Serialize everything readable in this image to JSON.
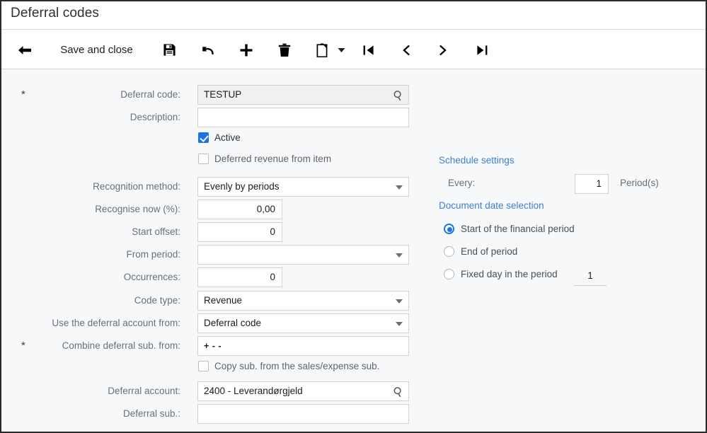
{
  "window": {
    "title": "Deferral codes"
  },
  "toolbar": {
    "back_icon": "back-arrow-icon",
    "save_and_close_label": "Save and close",
    "save_icon": "save-floppy-icon",
    "undo_icon": "undo-arrow-icon",
    "add_icon": "plus-icon",
    "delete_icon": "trash-icon",
    "clipboard_icon": "clipboard-icon",
    "clipboard_caret": "chevron-down-icon",
    "first_icon": "first-record-icon",
    "prev_icon": "previous-record-icon",
    "next_icon": "next-record-icon",
    "last_icon": "last-record-icon"
  },
  "form": {
    "deferral_code": {
      "label": "Deferral code:",
      "value": "TESTUP",
      "required": "*",
      "icon": "magnifier-icon"
    },
    "description": {
      "label": "Description:",
      "value": ""
    },
    "active": {
      "label": "Active",
      "checked": "true"
    },
    "deferred_revenue_from_item": {
      "label": "Deferred revenue from item",
      "checked": "false"
    },
    "recognition_method": {
      "label": "Recognition method:",
      "value": "Evenly by periods",
      "icon": "chevron-down-icon"
    },
    "recognise_now": {
      "label": "Recognise now (%):",
      "value": "0,00"
    },
    "start_offset": {
      "label": "Start offset:",
      "value": "0"
    },
    "from_period": {
      "label": "From period:",
      "value": "",
      "icon": "chevron-down-icon"
    },
    "occurrences": {
      "label": "Occurrences:",
      "value": "0"
    },
    "code_type": {
      "label": "Code type:",
      "value": "Revenue",
      "icon": "chevron-down-icon"
    },
    "use_deferral_account_from": {
      "label": "Use the deferral account from:",
      "value": "Deferral code",
      "icon": "chevron-down-icon"
    },
    "combine_deferral_sub_from": {
      "label": "Combine deferral sub. from:",
      "value": "+ -  -",
      "required": "*"
    },
    "copy_sub": {
      "label": "Copy sub. from the sales/expense sub.",
      "checked": "false"
    },
    "deferral_account": {
      "label": "Deferral account:",
      "value": "2400 - Leverandørgjeld",
      "icon": "magnifier-icon"
    },
    "deferral_sub": {
      "label": "Deferral sub.:",
      "value": ""
    }
  },
  "schedule": {
    "heading": "Schedule settings",
    "every": {
      "label": "Every:",
      "value": "1",
      "suffix": "Period(s)"
    },
    "document_date_heading": "Document date selection",
    "options": [
      {
        "label": "Start of the financial period",
        "selected": "true"
      },
      {
        "label": "End of period",
        "selected": "false"
      },
      {
        "label": "Fixed day in the period",
        "selected": "false"
      }
    ],
    "fixed_day_value": "1"
  },
  "colors": {
    "accent": "#1a73e8",
    "link": "#3f7fd0",
    "panel_bg": "#f7f8f9",
    "field_border": "#cfd2d4",
    "readonly_bg": "#f1f1f1"
  }
}
